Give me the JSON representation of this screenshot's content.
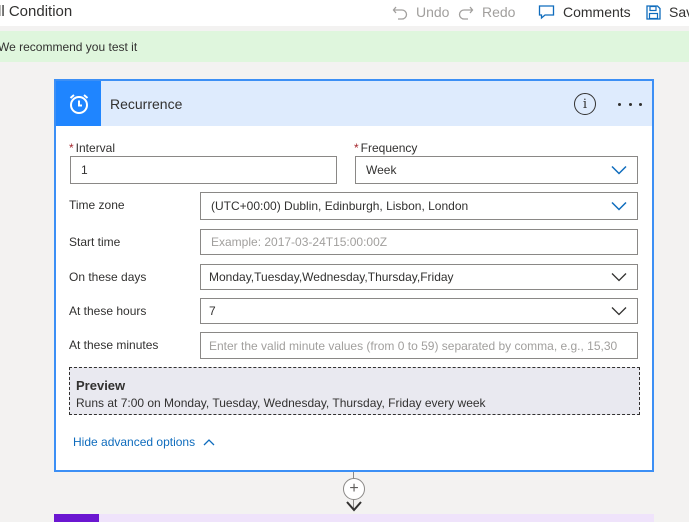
{
  "flow": {
    "title": "ll Condition"
  },
  "commands": {
    "undo": "Undo",
    "redo": "Redo",
    "comments": "Comments",
    "save": "Sav"
  },
  "banner": {
    "text": "We recommend you test it"
  },
  "card": {
    "title": "Recurrence",
    "info_glyph": "i",
    "fields": {
      "interval": {
        "label": "Interval",
        "required_mark": "*",
        "value": "1"
      },
      "frequency": {
        "label": "Frequency",
        "required_mark": "*",
        "value": "Week"
      },
      "time_zone": {
        "label": "Time zone",
        "value": "(UTC+00:00) Dublin, Edinburgh, Lisbon, London"
      },
      "start_time": {
        "label": "Start time",
        "placeholder": "Example: 2017-03-24T15:00:00Z"
      },
      "on_these_days": {
        "label": "On these days",
        "value": "Monday,Tuesday,Wednesday,Thursday,Friday"
      },
      "at_these_hours": {
        "label": "At these hours",
        "value": "7"
      },
      "at_these_minutes": {
        "label": "At these minutes",
        "placeholder": "Enter the valid minute values (from 0 to 59) separated by comma, e.g., 15,30"
      }
    },
    "preview": {
      "title": "Preview",
      "text": "Runs at 7:00 on Monday, Tuesday, Wednesday, Thursday, Friday every week"
    },
    "advanced_link": "Hide advanced options"
  },
  "connector": {
    "add_glyph": "+"
  },
  "colors": {
    "accent_blue": "#1f85ff",
    "card_border": "#3c8ff5",
    "header_bg": "#deebfd",
    "banner_bg": "#dff6dd",
    "link": "#0f6cbd",
    "required": "#a4262c",
    "next_action": "#6b17d1"
  },
  "icons": {
    "trigger": "alarm-clock-icon",
    "undo": "undo-icon",
    "redo": "redo-icon",
    "comments": "comment-icon",
    "save": "save-icon",
    "info": "info-icon",
    "more": "more-icon",
    "dropdown": "chevron-down-icon",
    "collapse": "chevron-up-icon",
    "add": "plus-icon",
    "arrow": "arrow-down-icon"
  }
}
